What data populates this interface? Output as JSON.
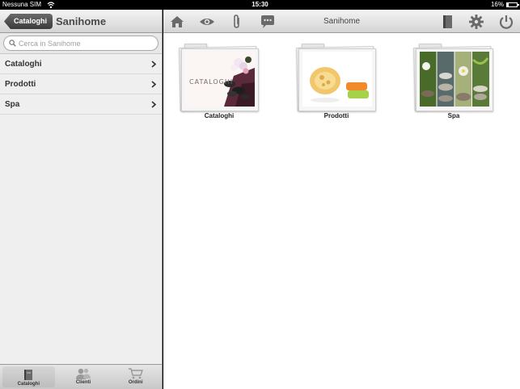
{
  "status": {
    "carrier": "Nessuna SIM",
    "time": "15:30",
    "battery_pct": "16%",
    "battery_level": 0.16
  },
  "left": {
    "back_label": "Cataloghi",
    "title": "Sanihome",
    "search_placeholder": "Cerca in Sanihome",
    "items": [
      {
        "label": "Cataloghi"
      },
      {
        "label": "Prodotti"
      },
      {
        "label": "Spa"
      }
    ],
    "tabs": [
      {
        "label": "Cataloghi",
        "icon": "book-icon",
        "active": true
      },
      {
        "label": "Clienti",
        "icon": "people-icon",
        "active": false
      },
      {
        "label": "Ordini",
        "icon": "cart-icon",
        "active": false
      }
    ]
  },
  "toolbar": {
    "title": "Sanihome",
    "icons": [
      "home-icon",
      "eye-icon",
      "paperclip-icon",
      "chat-icon",
      "book-icon",
      "gear-icon",
      "power-icon"
    ]
  },
  "folders": [
    {
      "caption": "Cataloghi",
      "photo_text": "CATALOGHI"
    },
    {
      "caption": "Prodotti"
    },
    {
      "caption": "Spa"
    }
  ]
}
